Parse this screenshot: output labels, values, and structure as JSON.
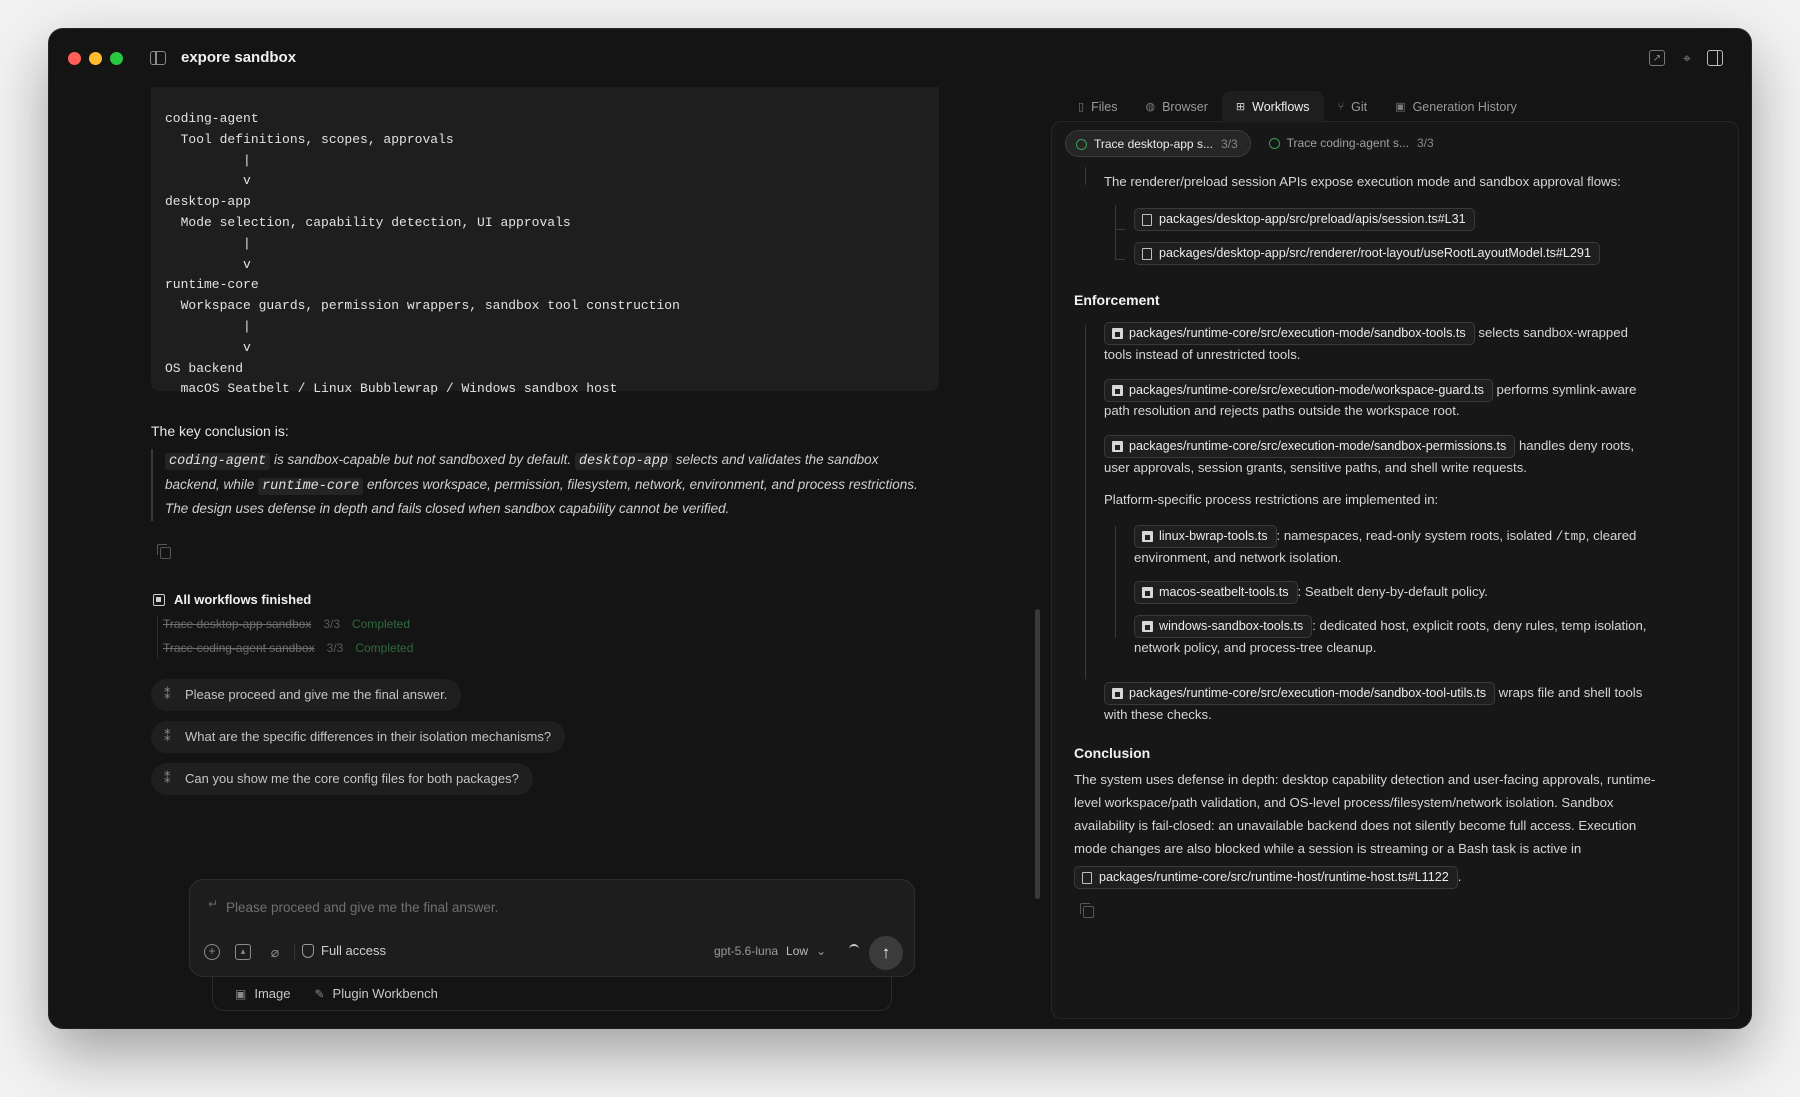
{
  "window": {
    "title": "expore sandbox"
  },
  "code_block": {
    "text": "coding-agent\n  Tool definitions, scopes, approvals\n          |\n          v\ndesktop-app\n  Mode selection, capability detection, UI approvals\n          |\n          v\nruntime-core\n  Workspace guards, permission wrappers, sandbox tool construction\n          |\n          v\nOS backend\n  macOS Seatbelt / Linux Bubblewrap / Windows sandbox host"
  },
  "chat": {
    "conclusion_label": "The key conclusion is:",
    "quote": {
      "code_1": "coding-agent",
      "text_1": " is sandbox-capable but not sandboxed by default. ",
      "code_2": "desktop-app",
      "text_2": " selects and validates the sandbox backend, while ",
      "code_3": "runtime-core",
      "text_3": " enforces workspace, permission, filesystem, network, environment, and process restrictions. The design uses defense in depth and fails closed when sandbox capability cannot be verified."
    },
    "workflows": {
      "status": "All workflows finished",
      "items": [
        {
          "name": "Trace desktop-app sandbox",
          "count": "3/3",
          "status": "Completed"
        },
        {
          "name": "Trace coding-agent sandbox",
          "count": "3/3",
          "status": "Completed"
        }
      ]
    },
    "suggestions": [
      "Please proceed and give me the final answer.",
      "What are the specific differences in their isolation mechanisms?",
      "Can you show me the core config files for both packages?"
    ]
  },
  "composer": {
    "placeholder": "Please proceed and give me the final answer.",
    "access_label": "Full access",
    "model": "gpt-5.6-luna",
    "effort": "Low",
    "tray": {
      "image_label": "Image",
      "plugin_label": "Plugin Workbench"
    }
  },
  "right_panel": {
    "tabs": [
      {
        "label": "Files",
        "icon": "file-icon"
      },
      {
        "label": "Browser",
        "icon": "globe-icon"
      },
      {
        "label": "Workflows",
        "icon": "workflow-icon"
      },
      {
        "label": "Git",
        "icon": "git-branch-icon"
      },
      {
        "label": "Generation History",
        "icon": "image-icon"
      }
    ],
    "active_tab": "Workflows",
    "subtabs": [
      {
        "label": "Trace desktop-app s...",
        "count": "3/3"
      },
      {
        "label": "Trace coding-agent s...",
        "count": "3/3"
      }
    ],
    "intro": "The renderer/preload session APIs expose execution mode and sandbox approval flows:",
    "intro_files": [
      "packages/desktop-app/src/preload/apis/session.ts#L31",
      "packages/desktop-app/src/renderer/root-layout/useRootLayoutModel.ts#L291"
    ],
    "enforcement": {
      "heading": "Enforcement",
      "items": [
        {
          "file": "packages/runtime-core/src/execution-mode/sandbox-tools.ts",
          "text_a": " selects sandbox-wrapped",
          "text_b": "tools instead of unrestricted tools."
        },
        {
          "file": "packages/runtime-core/src/execution-mode/workspace-guard.ts",
          "text_a": " performs symlink-aware",
          "text_b": "path resolution and rejects paths outside the workspace root."
        },
        {
          "file": "packages/runtime-core/src/execution-mode/sandbox-permissions.ts",
          "text_a": " handles deny roots,",
          "text_b": "user approvals, session grants, sensitive paths, and shell write requests."
        }
      ],
      "platform_intro": "Platform-specific process restrictions are implemented in:",
      "platform_items": [
        {
          "file": "linux-bwrap-tools.ts",
          "text_a": ": namespaces, read-only system roots, isolated ",
          "code": "/tmp",
          "text_c": ", cleared",
          "text_b": "environment, and network isolation."
        },
        {
          "file": "macos-seatbelt-tools.ts",
          "text_a": ": Seatbelt deny-by-default policy."
        },
        {
          "file": "windows-sandbox-tools.ts",
          "text_a": ": dedicated host, explicit roots, deny rules, temp isolation,",
          "text_b": "network policy, and process-tree cleanup."
        }
      ],
      "utils": {
        "file": "packages/runtime-core/src/execution-mode/sandbox-tool-utils.ts",
        "text_a": " wraps file and shell tools",
        "text_b": "with these checks."
      }
    },
    "conclusion": {
      "heading": "Conclusion",
      "lines": [
        "The system uses defense in depth: desktop capability detection and user-facing approvals, runtime-",
        "level workspace/path validation, and OS-level process/filesystem/network isolation. Sandbox",
        "availability is fail-closed: an unavailable backend does not silently become full access. Execution",
        "mode changes are also blocked while a session is streaming or a Bash task is active in"
      ],
      "file": "packages/runtime-core/src/runtime-host/runtime-host.ts#L1122",
      "end": "."
    }
  }
}
